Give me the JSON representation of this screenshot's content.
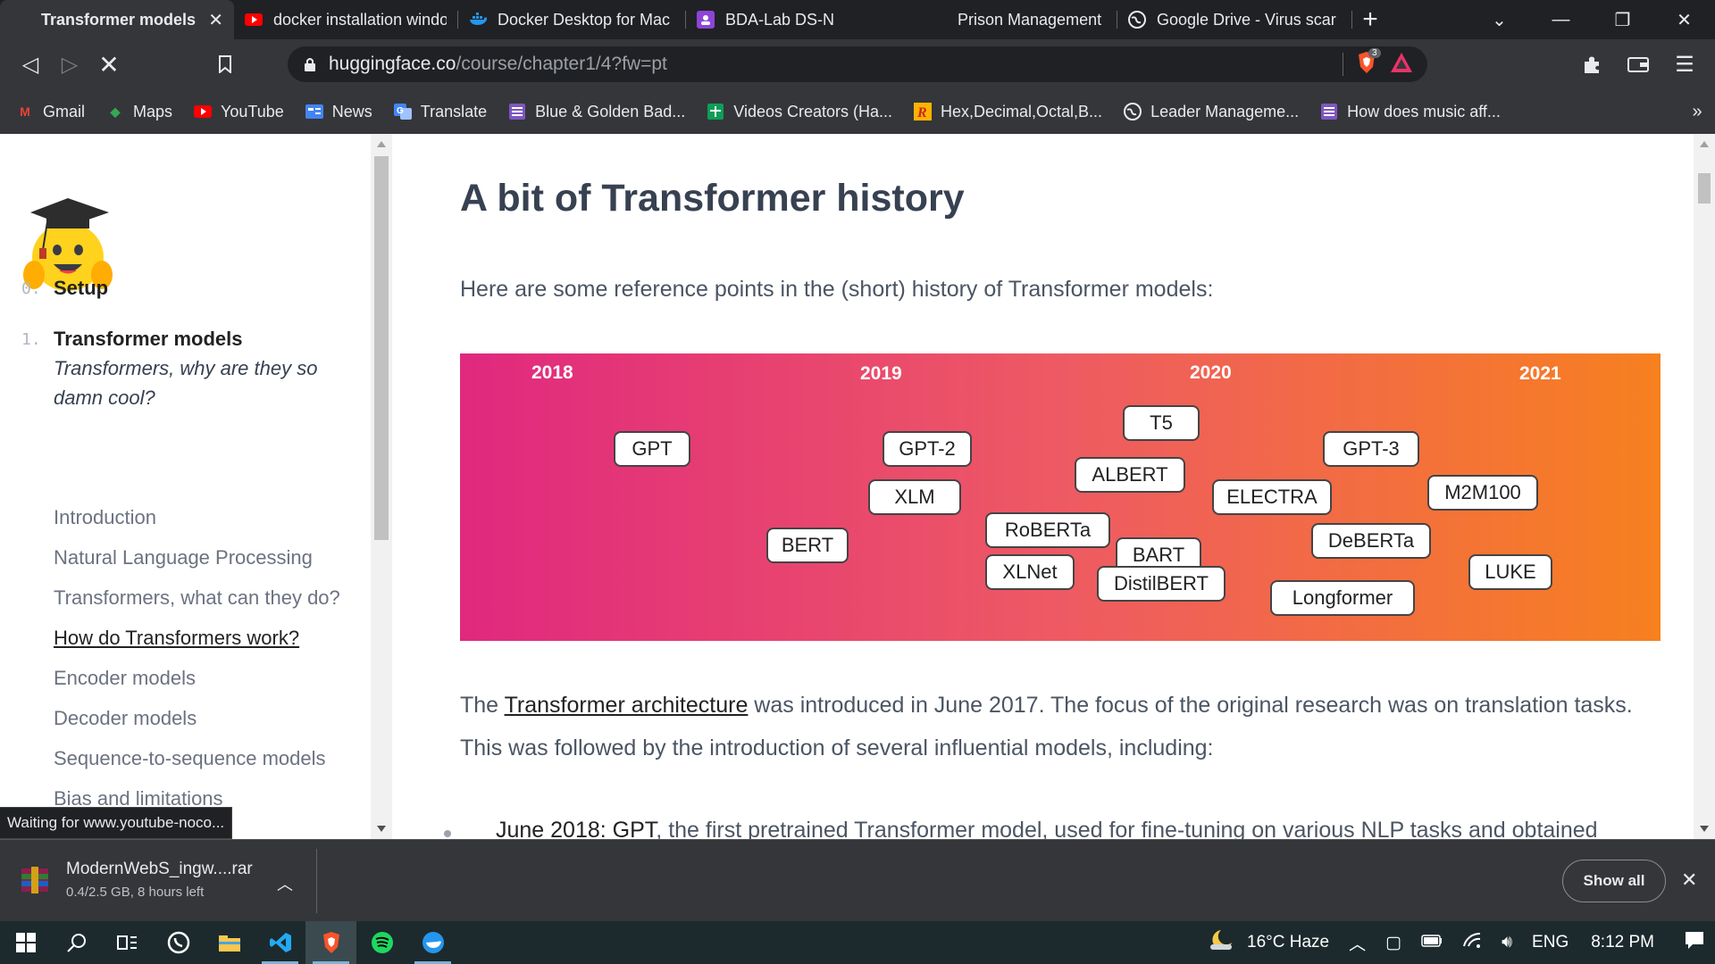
{
  "tabs": [
    {
      "title": "Transformer models",
      "icon": "huggingface-icon",
      "active": true
    },
    {
      "title": "docker installation windo",
      "icon": "youtube-icon"
    },
    {
      "title": "Docker Desktop for Mac",
      "icon": "docker-icon"
    },
    {
      "title": "BDA-Lab DS-N",
      "icon": "classroom-icon"
    },
    {
      "title": "Prison Management Syst",
      "icon": "page-icon"
    },
    {
      "title": "Google Drive - Virus scar",
      "icon": "globe-icon"
    }
  ],
  "address": {
    "host": "huggingface.co",
    "path": "/course/chapter1/4?fw=pt",
    "brave_badge": "3"
  },
  "bookmarks": [
    {
      "label": "Gmail",
      "icon": "gmail-icon",
      "color": "#ea4335"
    },
    {
      "label": "Maps",
      "icon": "maps-icon",
      "color": "#34a853"
    },
    {
      "label": "YouTube",
      "icon": "youtube-icon",
      "color": "#ff0000"
    },
    {
      "label": "News",
      "icon": "news-icon",
      "color": "#4285f4"
    },
    {
      "label": "Translate",
      "icon": "translate-icon",
      "color": "#4285f4"
    },
    {
      "label": "Blue & Golden Bad...",
      "icon": "list-icon",
      "color": "#7e57c2"
    },
    {
      "label": "Videos Creators (Ha...",
      "icon": "sheets-icon",
      "color": "#0f9d58"
    },
    {
      "label": "Hex,Decimal,Octal,B...",
      "icon": "r-icon",
      "color": "#e65100"
    },
    {
      "label": "Leader Manageme...",
      "icon": "globe-icon",
      "color": "#e8eaed"
    },
    {
      "label": "How does music aff...",
      "icon": "list-icon",
      "color": "#7e57c2"
    }
  ],
  "sidebar": {
    "chapters": [
      {
        "num": "0.",
        "label": "Setup"
      },
      {
        "num": "1.",
        "label": "Transformer models"
      }
    ],
    "items": [
      {
        "label": "Transformers, why are they so damn cool?",
        "style": "italic"
      },
      {
        "label": "Introduction"
      },
      {
        "label": "Natural Language Processing"
      },
      {
        "label": "Transformers, what can they do?"
      },
      {
        "label": "How do Transformers work?",
        "style": "current"
      },
      {
        "label": "Encoder models"
      },
      {
        "label": "Decoder models"
      },
      {
        "label": "Sequence-to-sequence models"
      },
      {
        "label": "Bias and limitations"
      }
    ]
  },
  "content": {
    "heading": "A bit of Transformer history",
    "intro": "Here are some reference points in the (short) history of Transformer models:",
    "timeline": {
      "years": [
        "2018",
        "2019",
        "2020",
        "2021"
      ],
      "models": [
        "GPT",
        "BERT",
        "GPT-2",
        "XLM",
        "RoBERTa",
        "XLNet",
        "T5",
        "ALBERT",
        "BART",
        "DistilBERT",
        "ELECTRA",
        "GPT-3",
        "DeBERTa",
        "Longformer",
        "M2M100",
        "LUKE"
      ]
    },
    "para1_pre": "The ",
    "para1_link": "Transformer architecture",
    "para1_post": " was introduced in June 2017. The focus of the original research was on translation tasks.",
    "para2": "This was followed by the introduction of several influential models, including:",
    "bullet_link": "June 2018: GPT",
    "bullet_text": ", the first pretrained Transformer model, used for fine-tuning on various NLP tasks and obtained"
  },
  "status_text": "Waiting for www.youtube-noco...",
  "download": {
    "filename": "ModernWebS_ingw....rar",
    "progress": "0.4/2.5 GB, 8 hours left",
    "show_all": "Show all"
  },
  "taskbar": {
    "weather": "16°C  Haze",
    "lang": "ENG",
    "time": "8:12 PM"
  }
}
